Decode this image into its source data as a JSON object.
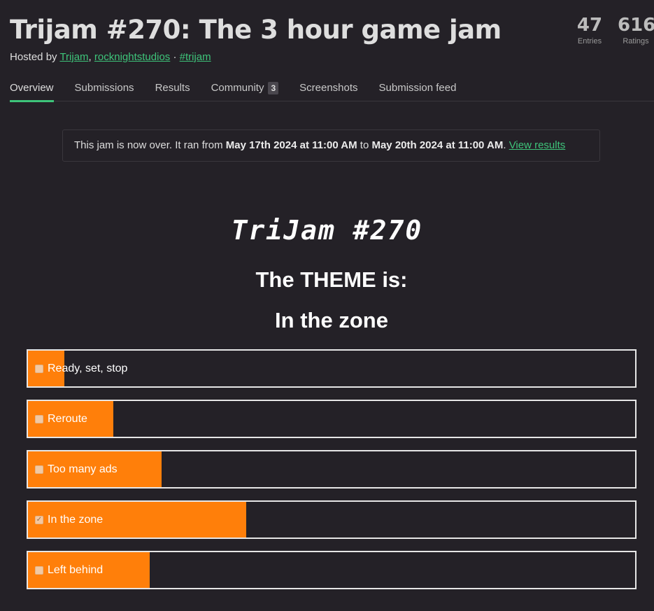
{
  "header": {
    "title": "Trijam #270: The 3 hour game jam",
    "hosted_prefix": "Hosted by ",
    "hosts": [
      "Trijam",
      "rocknightstudios"
    ],
    "comma": ",",
    "dot": "·",
    "tag": "#trijam"
  },
  "stats": [
    {
      "value": "47",
      "label": "Entries"
    },
    {
      "value": "616",
      "label": "Ratings"
    }
  ],
  "tabs": [
    {
      "label": "Overview",
      "active": true
    },
    {
      "label": "Submissions"
    },
    {
      "label": "Results"
    },
    {
      "label": "Community",
      "count": "3"
    },
    {
      "label": "Screenshots"
    },
    {
      "label": "Submission feed"
    }
  ],
  "notice": {
    "prefix": "This jam is now over. It ran from ",
    "start": "May 17th 2024 at 11:00 AM",
    "middle": " to ",
    "end": "May 20th 2024 at 11:00 AM",
    "suffix": ". ",
    "link": "View results"
  },
  "content": {
    "logo_title": "TriJam #270",
    "theme_label": "The THEME is:",
    "theme_name": "In the zone"
  },
  "poll": {
    "accent": "#ff7f0a",
    "options": [
      {
        "label": "Ready, set, stop",
        "share": 0.06,
        "checked": false
      },
      {
        "label": "Reroute",
        "share": 0.14,
        "checked": false
      },
      {
        "label": "Too many ads",
        "share": 0.22,
        "checked": false
      },
      {
        "label": "In the zone",
        "share": 0.36,
        "checked": true
      },
      {
        "label": "Left behind",
        "share": 0.2,
        "checked": false
      }
    ]
  }
}
